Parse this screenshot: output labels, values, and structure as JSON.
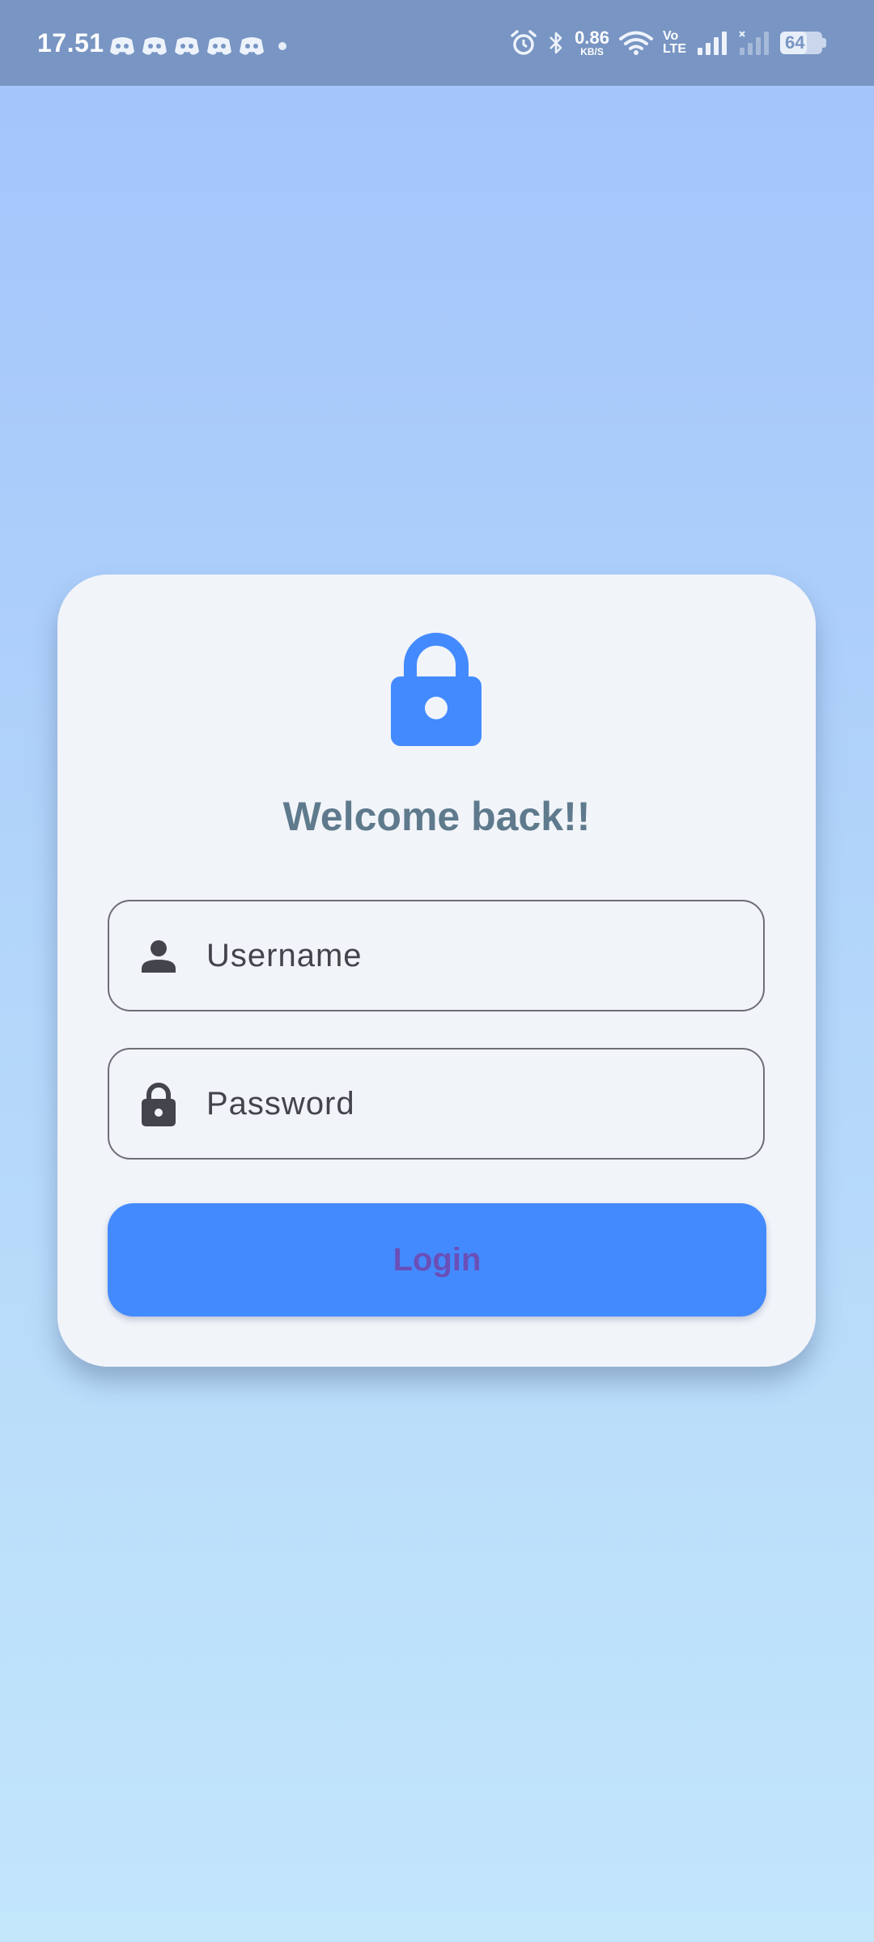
{
  "status_bar": {
    "time": "17.51",
    "notification_icons": [
      "discord-icon",
      "discord-icon",
      "discord-icon",
      "discord-icon",
      "discord-icon"
    ],
    "net_speed_value": "0.86",
    "net_speed_unit": "KB/S",
    "volte_top": "Vo",
    "volte_bottom": "LTE",
    "battery_level": "64"
  },
  "login_card": {
    "title": "Welcome back!!",
    "username_placeholder": "Username",
    "password_placeholder": "Password",
    "login_label": "Login"
  },
  "colors": {
    "accent": "#448aff",
    "status_bar": "#7895c3",
    "card": "#f1f4f9",
    "title_text": "#5e7a8c",
    "button_text": "#6a4fb8"
  }
}
